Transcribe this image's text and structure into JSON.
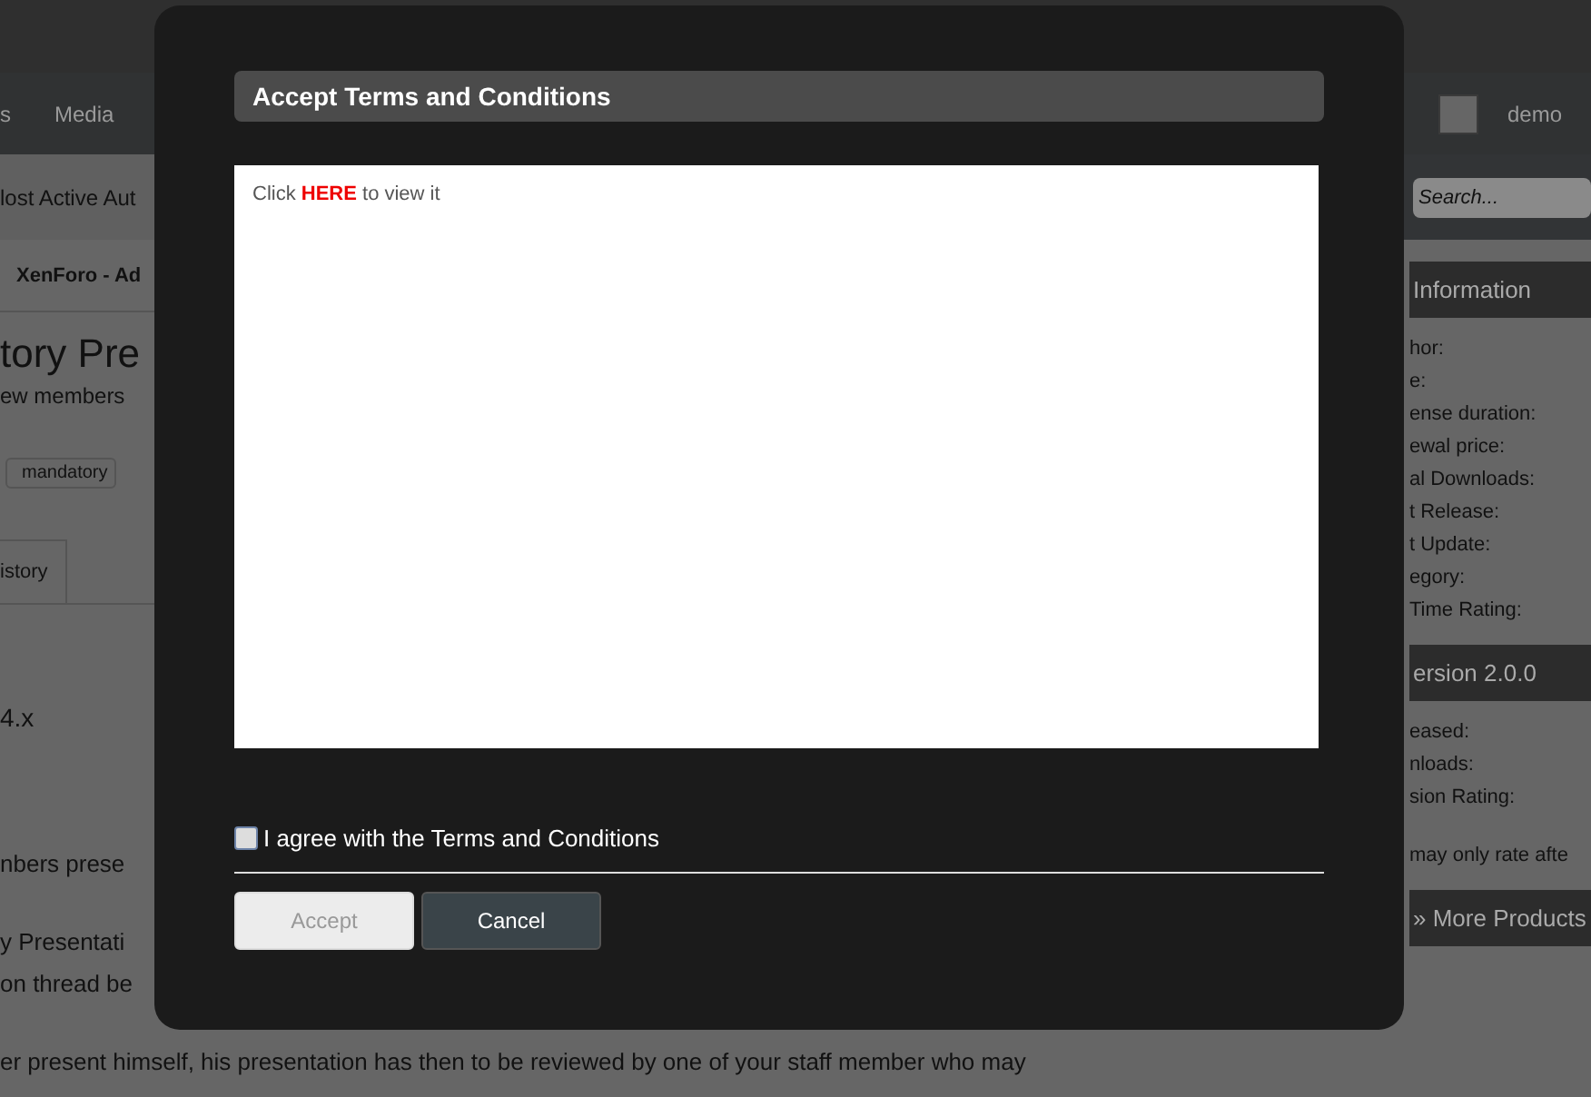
{
  "nav": {
    "items": [
      {
        "label": "s"
      },
      {
        "label": "Media"
      }
    ],
    "user": {
      "name": "demo"
    }
  },
  "subnav": {
    "items": [
      {
        "label": "lost Active Aut"
      }
    ]
  },
  "search": {
    "placeholder": "Search..."
  },
  "breadcrumb": {
    "label": "XenForo - Ad"
  },
  "resource": {
    "title": "tory Pre",
    "tagline": "ew members",
    "tags": [
      {
        "label": "mandatory"
      }
    ],
    "tabs": [
      {
        "label": "istory",
        "selected": false
      }
    ],
    "version_line": "4.x",
    "paragraphs": [
      "nbers prese",
      "y Presentati",
      "on thread be",
      "er present himself, his presentation has then to be reviewed by one of your staff member who may"
    ]
  },
  "sidebar": {
    "blocks": [
      {
        "title": "Information",
        "rows": [
          "hor:",
          "e:",
          "ense duration:",
          "ewal price:",
          "al Downloads:",
          "t Release:",
          "t Update:",
          "egory:",
          "Time Rating:"
        ]
      },
      {
        "title": "ersion 2.0.0",
        "rows": [
          "eased:",
          "nloads:",
          "sion Rating:"
        ],
        "note": "may only rate afte"
      },
      {
        "title": "» More Products"
      }
    ]
  },
  "dialog": {
    "title": "Accept Terms and Conditions",
    "body": "Click **HERE** to view it",
    "agree": {
      "label": "I agree with the Terms and Conditions",
      "checked": false
    },
    "buttons": [
      {
        "label": "Accept",
        "disabled": true
      },
      {
        "label": "Cancel",
        "disabled": false
      }
    ]
  }
}
